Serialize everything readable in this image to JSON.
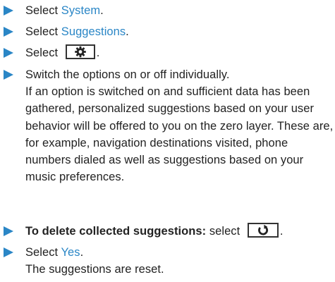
{
  "accent_color": "#2a86c6",
  "steps": [
    {
      "prefix": "Select ",
      "link": "System",
      "suffix": "."
    },
    {
      "prefix": "Select ",
      "link": "Suggestions",
      "suffix": "."
    },
    {
      "prefix": "Select ",
      "icon": "gear-icon",
      "suffix": "."
    },
    {
      "text": "Switch the options on or off individually.",
      "result": "If an option is switched on and sufficient data has been gathered, personalized suggestions based on your user behavior will be offered to you on the zero layer. These are, for example, navigation destinations visited, phone numbers dialed as well as suggestions based on your music preferences."
    },
    {
      "bold_prefix": "To delete collected suggestions:",
      "prefix": " select ",
      "icon": "reset-icon",
      "suffix": "."
    },
    {
      "prefix": "Select ",
      "link": "Yes",
      "suffix": ".",
      "result": "The suggestions are reset."
    }
  ]
}
